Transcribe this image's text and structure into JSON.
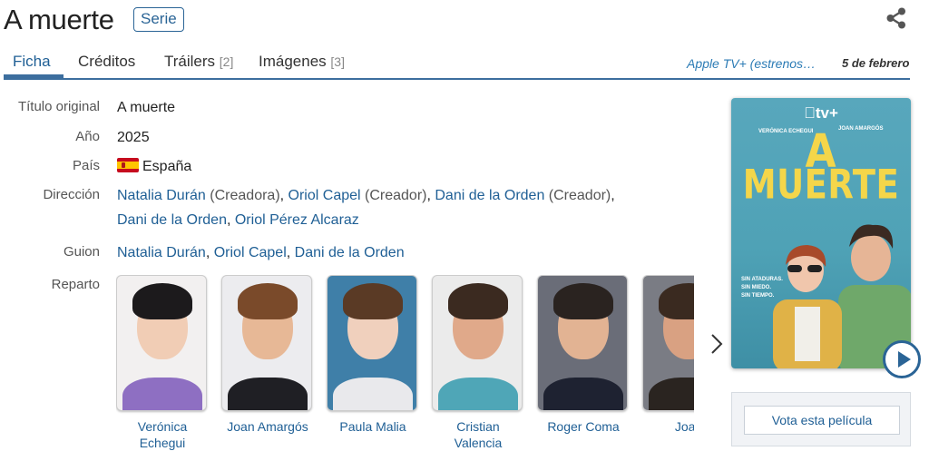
{
  "header": {
    "title": "A muerte",
    "type_badge": "Serie"
  },
  "tabs": [
    {
      "label": "Ficha",
      "count": ""
    },
    {
      "label": "Créditos",
      "count": ""
    },
    {
      "label": "Tráilers",
      "count": "[2]"
    },
    {
      "label": "Imágenes",
      "count": "[3]"
    }
  ],
  "release": {
    "platform": "Apple TV+ (estrenos…",
    "date": "5 de febrero"
  },
  "info": {
    "original_title_label": "Título original",
    "original_title": "A muerte",
    "year_label": "Año",
    "year": "2025",
    "country_label": "País",
    "country": "España",
    "direction_label": "Dirección",
    "direction": [
      {
        "name": "Natalia Durán",
        "role": "(Creadora)"
      },
      {
        "name": "Oriol Capel",
        "role": "(Creador)"
      },
      {
        "name": "Dani de la Orden",
        "role": "(Creador)"
      },
      {
        "name": "Dani de la Orden",
        "role": ""
      },
      {
        "name": "Oriol Pérez Alcaraz",
        "role": ""
      }
    ],
    "script_label": "Guion",
    "script": [
      "Natalia Durán",
      "Oriol Capel",
      "Dani de la Orden"
    ],
    "cast_label": "Reparto"
  },
  "cast": [
    {
      "name_line1": "Verónica",
      "name_line2": "Echegui",
      "skin": "#f1cdb5",
      "hair": "#1c1a1c",
      "clothes": "#8e6fc2",
      "bg": "#f2f0f0"
    },
    {
      "name_line1": "Joan Amargós",
      "name_line2": "",
      "skin": "#e7b896",
      "hair": "#7a4a2a",
      "clothes": "#1f1f24",
      "bg": "#ececef"
    },
    {
      "name_line1": "Paula Malia",
      "name_line2": "",
      "skin": "#f0d0bd",
      "hair": "#5a3a25",
      "clothes": "#e9e9ec",
      "bg": "#3f7fa8"
    },
    {
      "name_line1": "Cristian",
      "name_line2": "Valencia",
      "skin": "#e0a98a",
      "hair": "#3b2a20",
      "clothes": "#4fa6b7",
      "bg": "#ebebeb"
    },
    {
      "name_line1": "Roger Coma",
      "name_line2": "",
      "skin": "#e2b393",
      "hair": "#2a2320",
      "clothes": "#1e2231",
      "bg": "#6a6d78"
    },
    {
      "name_line1": "Joan",
      "name_line2": "",
      "skin": "#d9a182",
      "hair": "#3a2a20",
      "clothes": "#2a2420",
      "bg": "#7a7c84"
    }
  ],
  "poster": {
    "brand": "tv+",
    "actor_left": "VERÓNICA ECHEGUI",
    "actor_right": "JOAN AMARGÓS",
    "title_line1": "A",
    "title_line2": "MUERTE",
    "tagline": [
      "SIN ATADURAS.",
      "SIN MIEDO.",
      "SIN TIEMPO."
    ]
  },
  "vote": {
    "label": "Vota esta película"
  },
  "icons": {
    "share": "share-icon",
    "next": "chevron-right-icon",
    "play": "play-icon"
  }
}
